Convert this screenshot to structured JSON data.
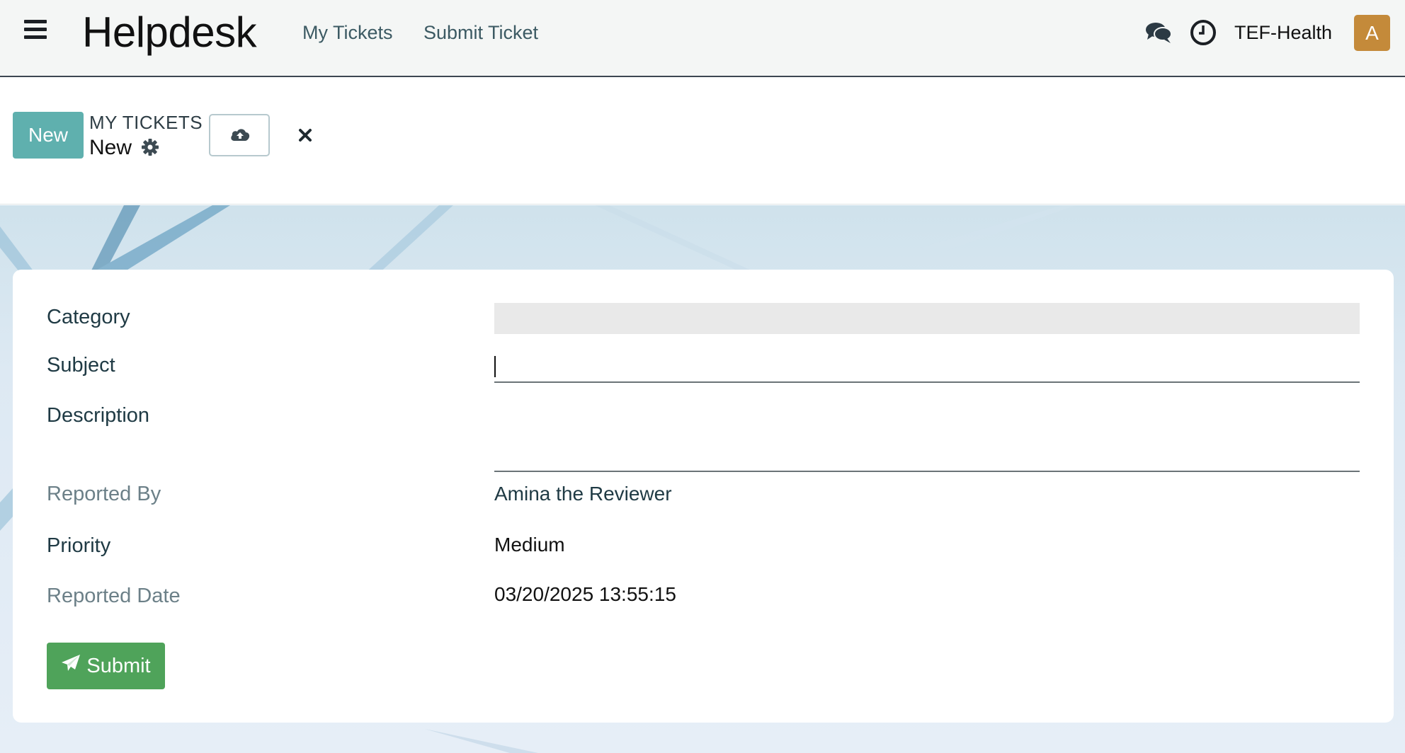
{
  "navbar": {
    "brand": "Helpdesk",
    "links": [
      "My Tickets",
      "Submit Ticket"
    ],
    "company": "TEF-Health",
    "avatar_initial": "A",
    "icons": [
      "menu-icon",
      "chat-icon",
      "clock-icon"
    ]
  },
  "control_panel": {
    "new_label": "New",
    "breadcrumb_parent": "MY TICKETS",
    "breadcrumb_current": "New",
    "icons": [
      "gear-icon",
      "cloud-upload-icon",
      "close-icon"
    ]
  },
  "form": {
    "category_label": "Category",
    "category_value": "",
    "subject_label": "Subject",
    "subject_value": "",
    "description_label": "Description",
    "description_value": "",
    "reported_by_label": "Reported By",
    "reported_by_value": "Amina the Reviewer",
    "priority_label": "Priority",
    "priority_value": "Medium",
    "reported_date_label": "Reported Date",
    "reported_date_value": "03/20/2025 13:55:15",
    "submit_label": "Submit"
  },
  "colors": {
    "new_button": "#5fb0ae",
    "submit_button": "#4fa35a",
    "avatar": "#c48a3a",
    "navbar_bg": "#f4f6f5"
  }
}
